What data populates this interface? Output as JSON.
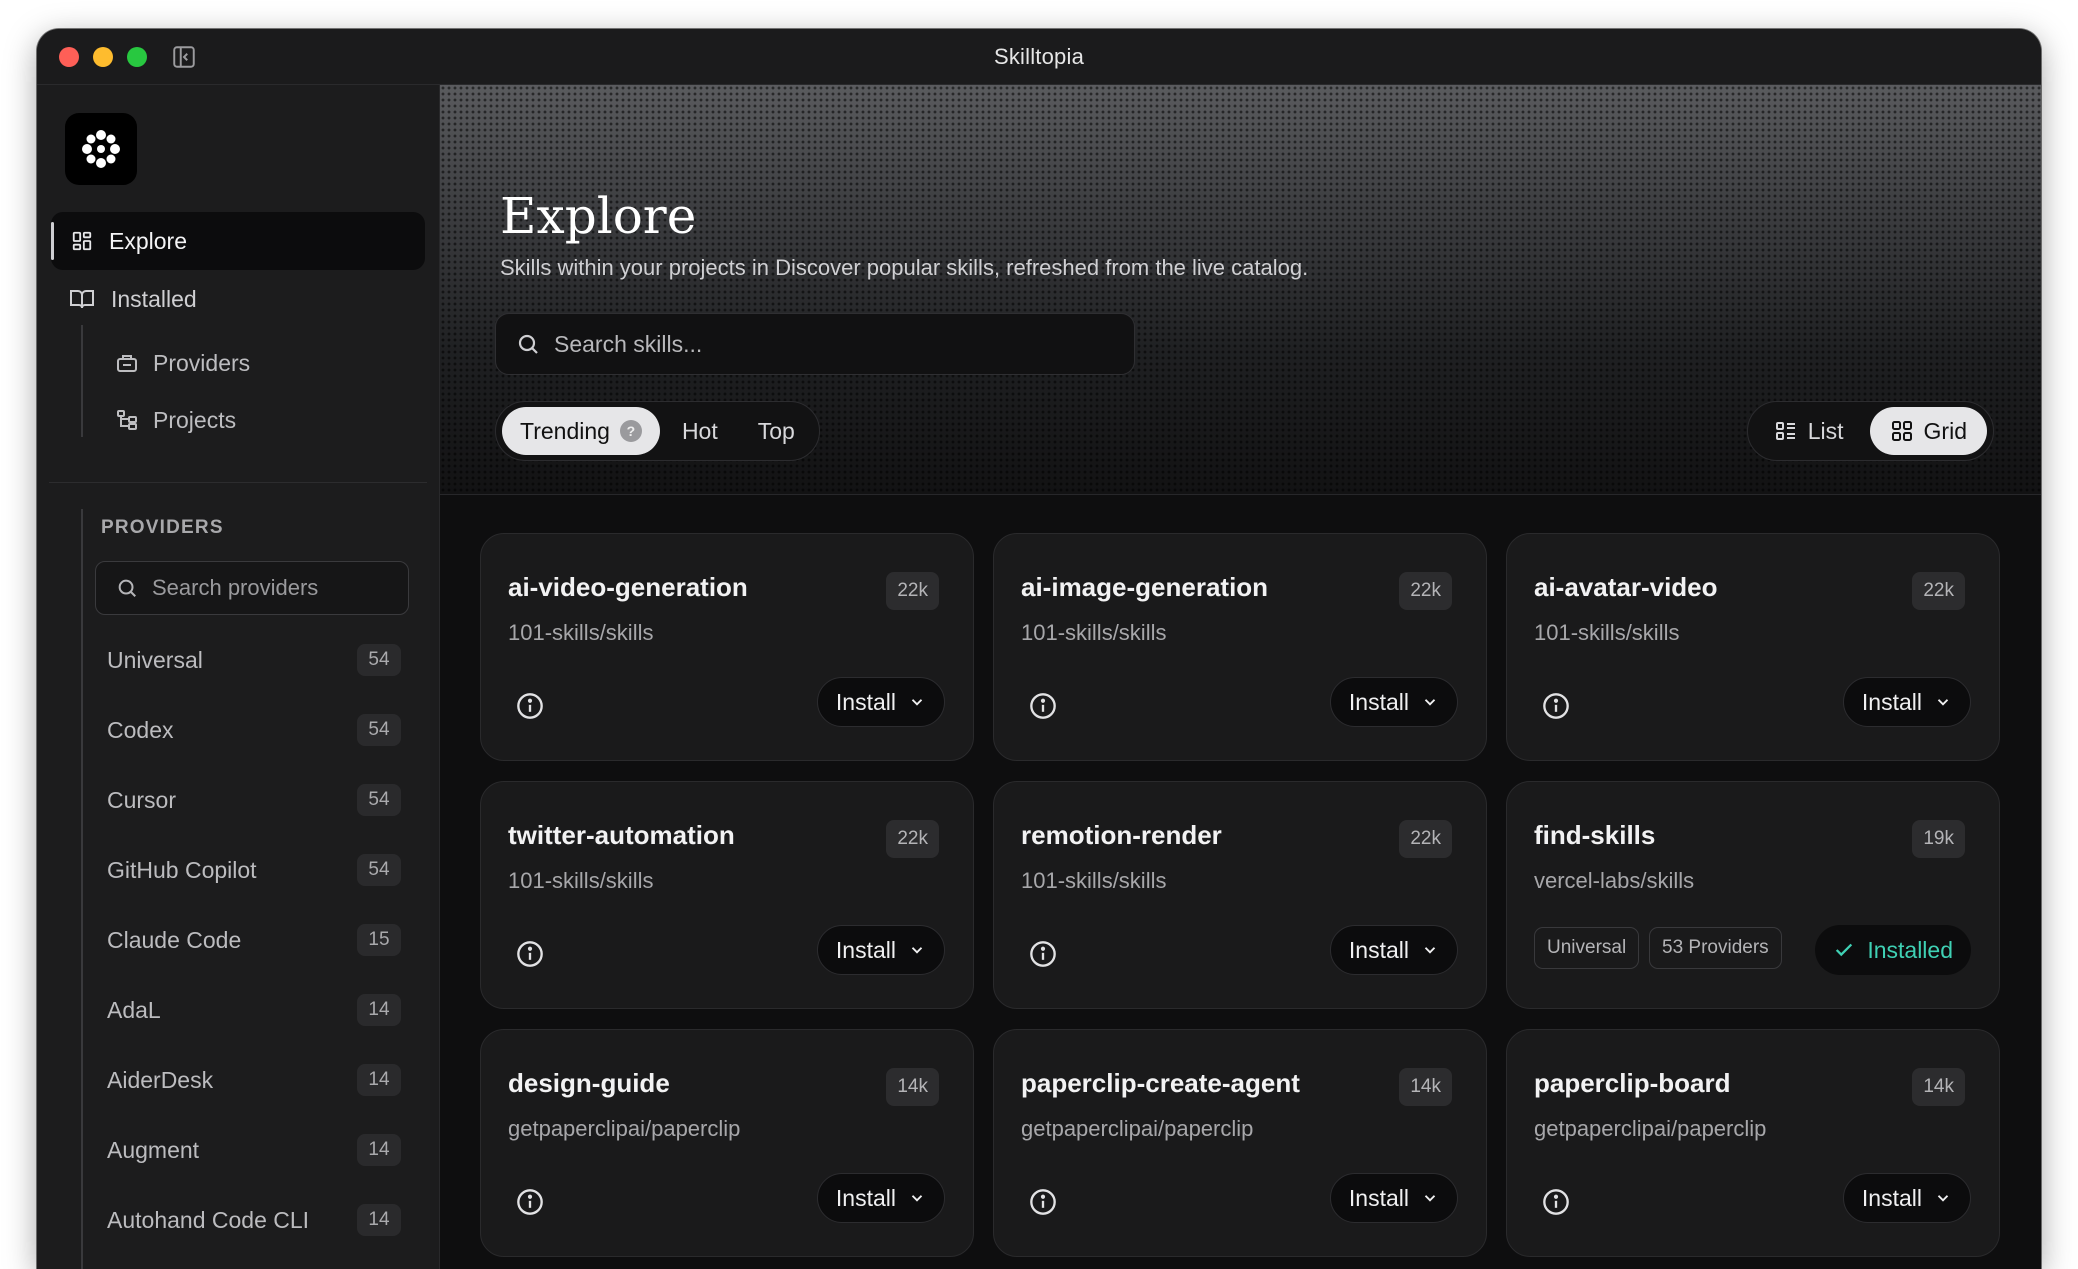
{
  "window": {
    "title": "Skilltopia"
  },
  "sidebar": {
    "nav": {
      "explore": "Explore",
      "installed": "Installed",
      "providers": "Providers",
      "projects": "Projects"
    },
    "providers_heading": "PROVIDERS",
    "providers_search_placeholder": "Search providers",
    "providers": [
      {
        "name": "Universal",
        "count": "54"
      },
      {
        "name": "Codex",
        "count": "54"
      },
      {
        "name": "Cursor",
        "count": "54"
      },
      {
        "name": "GitHub Copilot",
        "count": "54"
      },
      {
        "name": "Claude Code",
        "count": "15"
      },
      {
        "name": "AdaL",
        "count": "14"
      },
      {
        "name": "AiderDesk",
        "count": "14"
      },
      {
        "name": "Augment",
        "count": "14"
      },
      {
        "name": "Autohand Code CLI",
        "count": "14"
      }
    ]
  },
  "hero": {
    "title": "Explore",
    "subtitle": "Skills within your projects in Discover popular skills, refreshed from the live catalog.",
    "search_placeholder": "Search skills...",
    "tabs": {
      "trending": "Trending",
      "help": "?",
      "hot": "Hot",
      "top": "Top"
    },
    "view": {
      "list": "List",
      "grid": "Grid",
      "active": "Grid"
    }
  },
  "cards": [
    {
      "name": "ai-video-generation",
      "repo": "101-skills/skills",
      "count": "22k",
      "action": "Install"
    },
    {
      "name": "ai-image-generation",
      "repo": "101-skills/skills",
      "count": "22k",
      "action": "Install"
    },
    {
      "name": "ai-avatar-video",
      "repo": "101-skills/skills",
      "count": "22k",
      "action": "Install"
    },
    {
      "name": "twitter-automation",
      "repo": "101-skills/skills",
      "count": "22k",
      "action": "Install"
    },
    {
      "name": "remotion-render",
      "repo": "101-skills/skills",
      "count": "22k",
      "action": "Install"
    },
    {
      "name": "find-skills",
      "repo": "vercel-labs/skills",
      "count": "19k",
      "action": "Installed",
      "tags": [
        "Universal",
        "53 Providers"
      ]
    },
    {
      "name": "design-guide",
      "repo": "getpaperclipai/paperclip",
      "count": "14k",
      "action": "Install"
    },
    {
      "name": "paperclip-create-agent",
      "repo": "getpaperclipai/paperclip",
      "count": "14k",
      "action": "Install"
    },
    {
      "name": "paperclip-board",
      "repo": "getpaperclipai/paperclip",
      "count": "14k",
      "action": "Install"
    }
  ],
  "colors": {
    "accent_installed": "#3fd1b4",
    "background": "#0f0f10",
    "sidebar": "#1c1c1d"
  },
  "icons": [
    "app-logo-icon",
    "sidebar-toggle-icon",
    "grid-icon",
    "book-icon",
    "box-icon",
    "folder-tree-icon",
    "search-icon",
    "list-icon",
    "info-icon",
    "chevron-down-icon",
    "check-icon"
  ]
}
